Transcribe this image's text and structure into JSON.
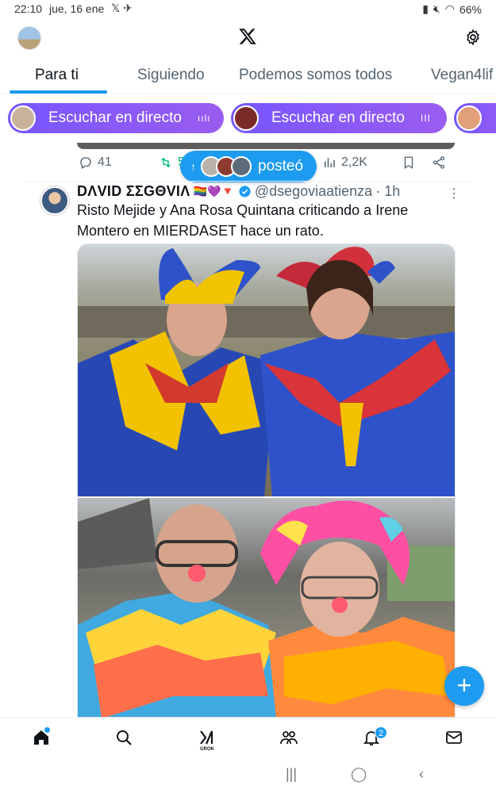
{
  "status_bar": {
    "time": "22:10",
    "date": "jue, 16 ene",
    "battery": "66%"
  },
  "tabs": [
    "Para ti",
    "Siguiendo",
    "Podemos somos todos",
    "Vegan4lif"
  ],
  "spaces": [
    {
      "label": "Escuchar en directo",
      "bars": "ıılı",
      "avatar_color": "#c8b39a"
    },
    {
      "label": "Escuchar en directo",
      "bars": "III",
      "avatar_color": "#7b2a2a"
    },
    {
      "label": "",
      "bars": "",
      "avatar_color": "#e1a07a"
    }
  ],
  "prev_tweet_actions": {
    "replies": "41",
    "retweets": "5",
    "views": "2,2K"
  },
  "posted_pill": {
    "label": "posteó"
  },
  "tweet": {
    "display_name": "DΛVID ƩƩGΘVIΛ",
    "handle": "@dsegoviaatienza",
    "time": "· 1h",
    "text": "Risto Mejide y Ana Rosa Quintana criticando a Irene Montero en MIERDASET hace un rato."
  },
  "bottom_nav": {
    "notifications_badge": "2",
    "grok_label": "GROK"
  },
  "colors": {
    "accent": "#1d9bf0",
    "spaces_purple": "#7856ff",
    "text_secondary": "#536471"
  }
}
